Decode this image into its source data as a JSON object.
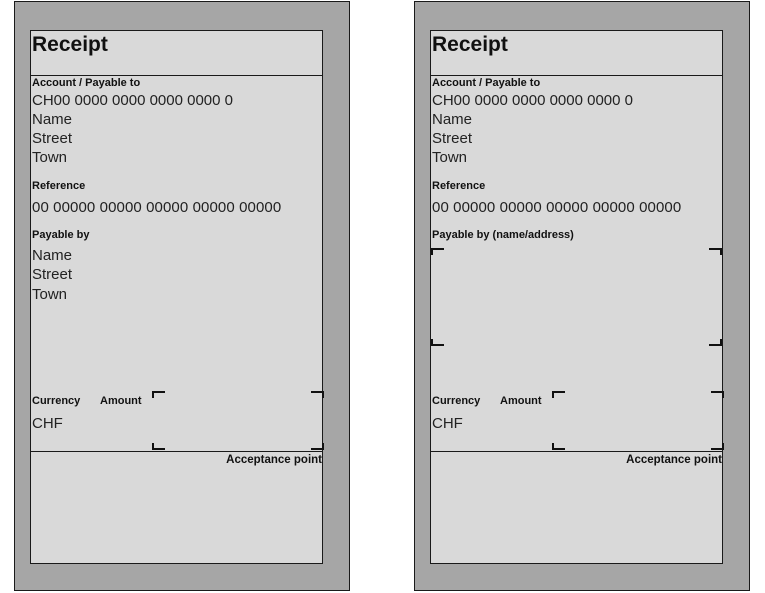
{
  "left": {
    "title": "Receipt",
    "account_heading": "Account / Payable to",
    "account_lines": [
      "CH00 0000 0000 0000 0000 0",
      "Name",
      "Street",
      "Town"
    ],
    "reference_heading": "Reference",
    "reference_value": "00 00000 00000 00000 00000 00000",
    "payable_by_heading": "Payable by",
    "payable_by_lines": [
      "Name",
      "Street",
      "Town"
    ],
    "currency_heading": "Currency",
    "amount_heading": "Amount",
    "currency_value": "CHF",
    "acceptance_point": "Acceptance point"
  },
  "right": {
    "title": "Receipt",
    "account_heading": "Account / Payable to",
    "account_lines": [
      "CH00 0000 0000 0000 0000 0",
      "Name",
      "Street",
      "Town"
    ],
    "reference_heading": "Reference",
    "reference_value": "00 00000 00000 00000 00000 00000",
    "payable_by_heading": "Payable by (name/address)",
    "currency_heading": "Currency",
    "amount_heading": "Amount",
    "currency_value": "CHF",
    "acceptance_point": "Acceptance point"
  }
}
